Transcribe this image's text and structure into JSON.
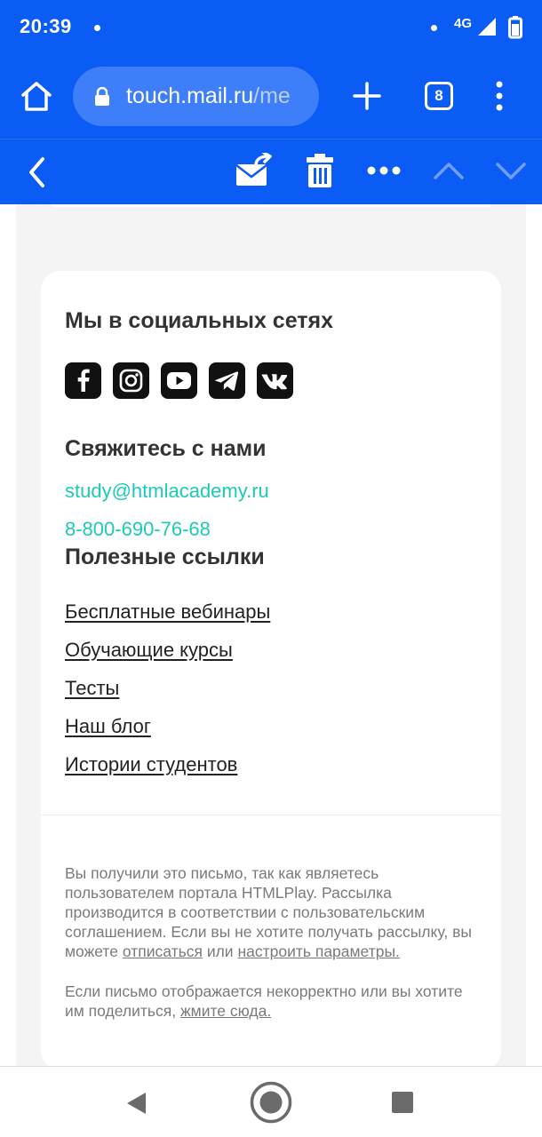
{
  "status_bar": {
    "time": "20:39",
    "network": "4G"
  },
  "browser": {
    "url_host": "touch.mail.ru",
    "url_path": "/me",
    "tab_count": "8"
  },
  "mail_toolbar": {
    "icons": [
      "back-arrow",
      "move-to-folder",
      "trash",
      "more-dots",
      "previous-message",
      "next-message"
    ]
  },
  "email": {
    "social": {
      "title": "Мы в социальных сетях",
      "networks": [
        "facebook",
        "instagram",
        "youtube",
        "telegram",
        "vk"
      ]
    },
    "contacts": {
      "title": "Свяжитесь с нами",
      "email": "study@htmlacademy.ru",
      "phone": "8-800-690-76-68"
    },
    "useful_links": {
      "title": "Полезные ссылки",
      "items": [
        "Бесплатные вебинары",
        "Обучающие курсы",
        "Тесты",
        "Наш блог",
        "Истории студентов"
      ]
    },
    "footer": {
      "notice_text": "Вы получили это письмо, так как являетесь пользователем портала HTMLPlay. Рассылка производится в соответствии с пользовательским соглашением. Если вы не хотите получать рассылку, вы можете",
      "unsubscribe_link": "отписаться",
      "or_text": "или",
      "settings_link": "настроить параметры.",
      "display_text": "Если письмо отображается некорректно или вы хотите им поделиться,",
      "click_here_link": "жмите сюда."
    }
  },
  "colors": {
    "brand_blue": "#0a5cf5",
    "link_teal": "#1ccbb6",
    "heading": "#333333"
  }
}
